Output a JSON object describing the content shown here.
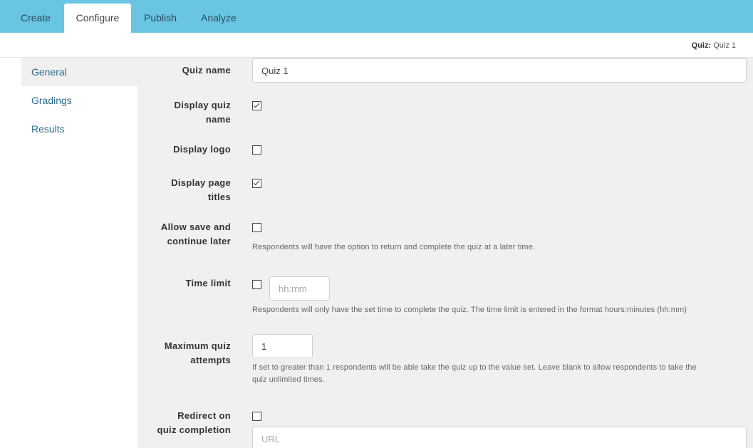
{
  "tabs": [
    "Create",
    "Configure",
    "Publish",
    "Analyze"
  ],
  "breadcrumb": {
    "label": "Quiz:",
    "value": "Quiz 1"
  },
  "sidebar": {
    "items": [
      "General",
      "Gradings",
      "Results"
    ]
  },
  "form": {
    "quiz_name": {
      "label": "Quiz name",
      "value": "Quiz 1"
    },
    "display_quiz_name": {
      "label_line1": "Display quiz",
      "label_line2": "name",
      "checked": true
    },
    "display_logo": {
      "label": "Display logo",
      "checked": false
    },
    "display_page_titles": {
      "label_line1": "Display page",
      "label_line2": "titles",
      "checked": true
    },
    "allow_save": {
      "label_line1": "Allow save and",
      "label_line2": "continue later",
      "checked": false,
      "help": "Respondents will have the option to return and complete the quiz at a later time."
    },
    "time_limit": {
      "label": "Time limit",
      "checked": false,
      "placeholder": "hh:mm",
      "help": "Respondents will only have the set time to complete the quiz. The time limit is entered in the format hours:minutes (hh:mm)"
    },
    "max_attempts": {
      "label_line1": "Maximum quiz",
      "label_line2": "attempts",
      "value": "1",
      "help_line1": "If set to greater than 1 respondents will be able take the quiz up to the value set. Leave blank to allow respondents to take the",
      "help_line2": "quiz unlimited times."
    },
    "redirect": {
      "label_line1": "Redirect on",
      "label_line2": "quiz completion",
      "checked": false,
      "placeholder": "URL"
    }
  }
}
